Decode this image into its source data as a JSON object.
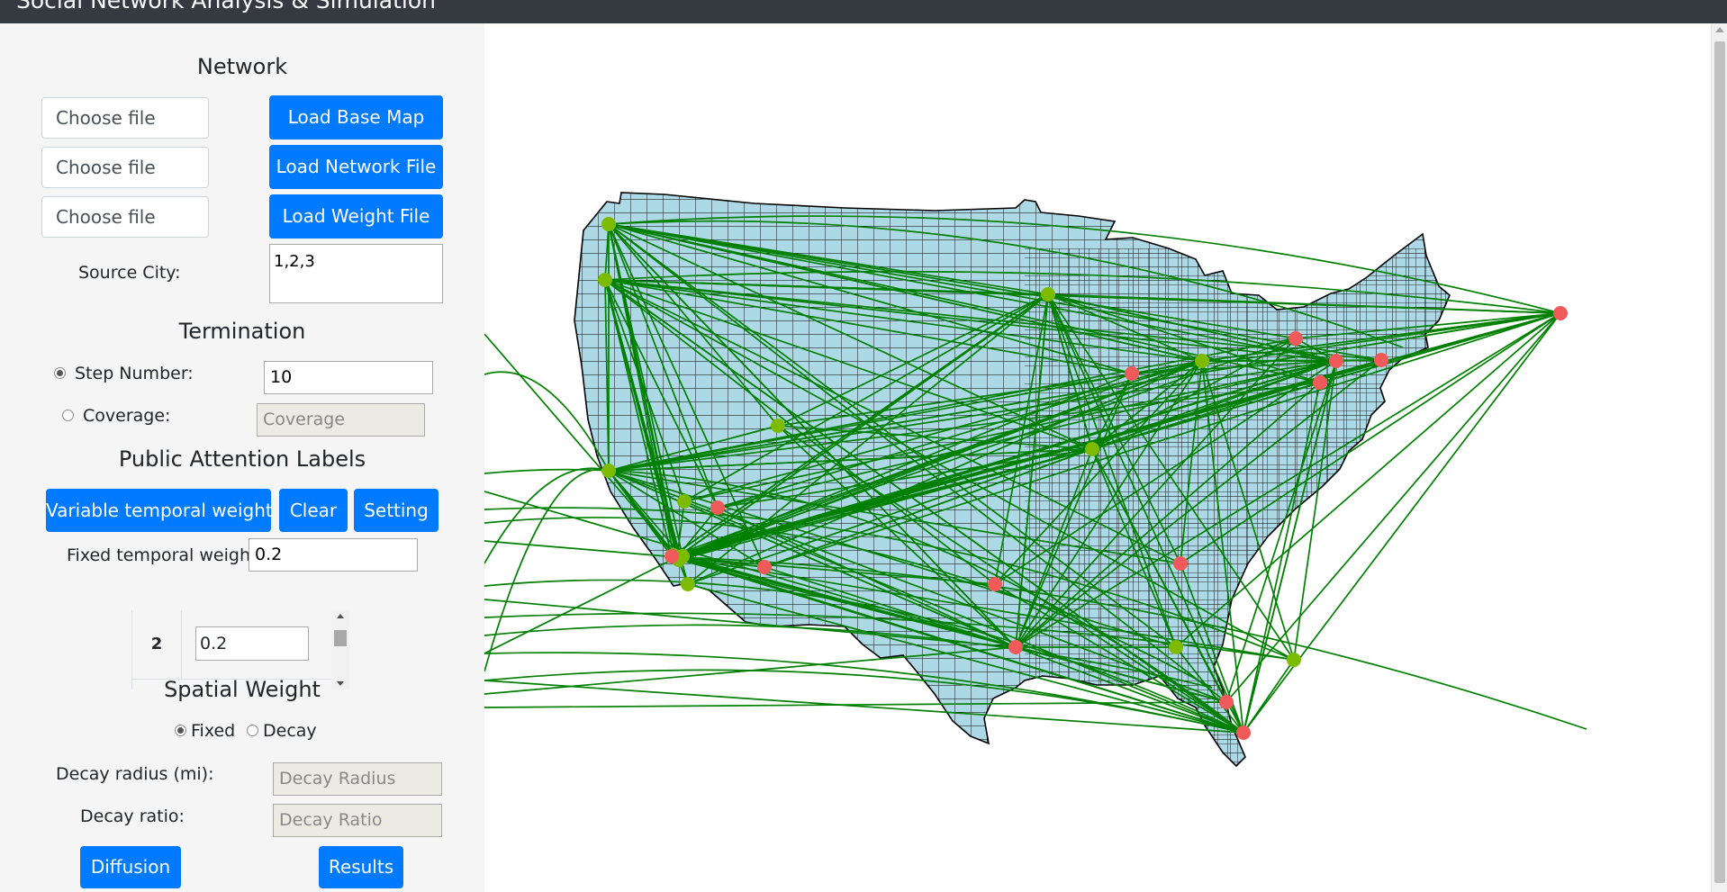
{
  "app": {
    "title": "Social Network Analysis & Simulation"
  },
  "network": {
    "heading": "Network",
    "file_placeholder": "Choose file",
    "load_base_map": "Load Base Map",
    "load_network_file": "Load Network File",
    "load_weight_file": "Load Weight File",
    "source_city_label": "Source City:",
    "source_city_value": "1,2,3"
  },
  "termination": {
    "heading": "Termination",
    "step_number_label": "Step Number:",
    "step_number_value": "10",
    "step_selected": true,
    "coverage_label": "Coverage:",
    "coverage_placeholder": "Coverage"
  },
  "attention": {
    "heading": "Public Attention Labels",
    "variable_button": "Variable temporal weight",
    "clear_button": "Clear",
    "setting_button": "Setting",
    "fixed_label": "Fixed temporal weight",
    "fixed_value": "0.2",
    "rows": [
      {
        "step": "2",
        "value": "0.2"
      }
    ]
  },
  "spatial": {
    "heading": "Spatial Weight",
    "fixed_label": "Fixed",
    "decay_label": "Decay",
    "selected": "Fixed",
    "radius_label": "Decay radius (mi):",
    "radius_placeholder": "Decay Radius",
    "ratio_label": "Decay ratio:",
    "ratio_placeholder": "Decay Ratio"
  },
  "actions": {
    "diffusion": "Diffusion",
    "results": "Results"
  },
  "map": {
    "land_color": "#add8e6",
    "border_color": "#000000",
    "edge_color": "#008000",
    "green_node_color": "#7cbb00",
    "red_node_color": "#f05a5a",
    "green_node_count": 15,
    "red_node_count": 14
  },
  "colors": {
    "accent": "#007bff",
    "sidebar_bg": "#f5f5f5",
    "topbar_bg": "#343a40"
  }
}
